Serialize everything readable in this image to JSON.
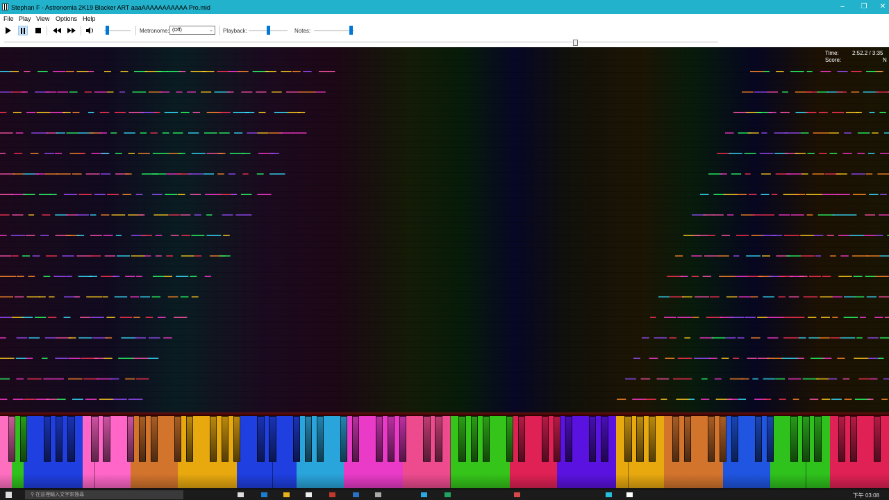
{
  "window": {
    "title": "Stephan F - Astronomia 2K19 Blacker ART  aaaAAAAAAAAAAA Pro.mid",
    "minimize": "–",
    "maximize": "❐",
    "close": "✕"
  },
  "menu": {
    "items": [
      "File",
      "Play",
      "View",
      "Options",
      "Help"
    ]
  },
  "toolbar": {
    "play_icon": "play-icon",
    "pause_icon": "pause-icon",
    "stop_icon": "stop-icon",
    "rewind_icon": "rewind-icon",
    "forward_icon": "fast-forward-icon",
    "volume_icon": "speaker-icon",
    "volume_level": 0.05,
    "metronome_label": "Metronome:",
    "metronome_value": "(Off)",
    "playback_label": "Playback:",
    "playback_level": 0.5,
    "notes_label": "Notes:",
    "notes_level": 0.97
  },
  "seek": {
    "position": 0.8
  },
  "hud": {
    "time_label": "Time:",
    "time_value": "2:52.2 / 3:35",
    "score_label": "Score:",
    "score_value": "N"
  },
  "keyboard": {
    "white_key_colors": [
      "#ff6fc0",
      "#2fc21c",
      "#1f3fe0",
      "#1f3fe0",
      "#1f3fe0",
      "#1f3fe0",
      "#1f3fe0",
      "#ff66c8",
      "#ff66c8",
      "#ff66c8",
      "#ff66c8",
      "#d3742d",
      "#d3742d",
      "#d3742d",
      "#d3742d",
      "#e8a90f",
      "#e8a90f",
      "#e8a90f",
      "#e8a90f",
      "#e8a90f",
      "#1f3fe0",
      "#1f3fe0",
      "#1f3fe0",
      "#1f3fe0",
      "#1f3fe0",
      "#2aa5dc",
      "#2aa5dc",
      "#2aa5dc",
      "#2aa5dc",
      "#e93bc8",
      "#e93bc8",
      "#e93bc8",
      "#e93bc8",
      "#e93bc8",
      "#ee4b8f",
      "#ee4b8f",
      "#ee4b8f",
      "#ee4b8f",
      "#35c41a",
      "#35c41a",
      "#35c41a",
      "#35c41a",
      "#35c41a",
      "#e02155",
      "#e02155",
      "#e02155",
      "#e02155",
      "#5a12e0",
      "#5a12e0",
      "#5a12e0",
      "#5a12e0",
      "#5a12e0",
      "#e8a90f",
      "#e8a90f",
      "#e8a90f",
      "#e8a90f",
      "#d3742d",
      "#d3742d",
      "#d3742d",
      "#d3742d",
      "#d3742d",
      "#1f55e0",
      "#1f55e0",
      "#1f55e0",
      "#1f55e0",
      "#2fc21c",
      "#2fc21c",
      "#2fc21c",
      "#2fc21c",
      "#2fc21c",
      "#e02155",
      "#e02155",
      "#e02155",
      "#e02155",
      "#e02155"
    ]
  },
  "taskbar": {
    "search_text": "在這裡輸入文字來搜尋",
    "clock": "下午 03:08"
  },
  "colors": {
    "title_bar": "#23b2cb",
    "accent": "#0078d7"
  }
}
